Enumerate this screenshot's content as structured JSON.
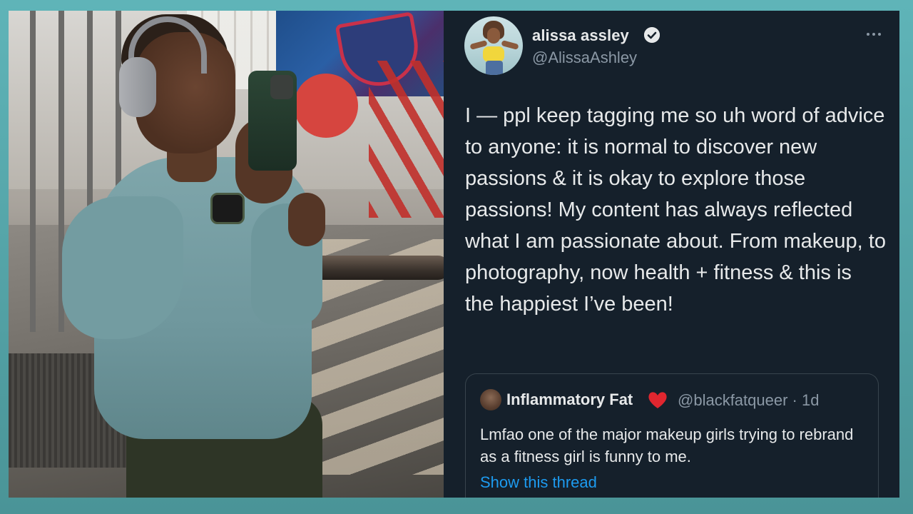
{
  "tweet": {
    "author": {
      "display_name": "alissa assley",
      "handle": "@AlissaAshley",
      "verified": true
    },
    "text": "I — ppl keep tagging me so uh word of advice to anyone: it is normal to discover new passions & it is okay to explore those passions! My content has always reflected what I am passionate about. From makeup, to photography, now health + fitness & this is the happiest I’ve been!",
    "quoted_tweet": {
      "display_name": "Inflammatory Fat",
      "emoji": "❤️",
      "handle_time": "@blackfatqueer · 1d",
      "text": "Lmfao one of the major makeup girls trying to rebrand as a fitness girl is funny to me.",
      "link_label": "Show this thread"
    }
  },
  "icons": [
    "verified-icon",
    "more-options-icon",
    "red-heart-icon"
  ],
  "colors": {
    "background_frame": "#5fb4b8",
    "tweet_bg": "#15202b",
    "text_primary": "#e7e9ea",
    "text_secondary": "#8b98a5",
    "link": "#1d9bf0",
    "border": "#38444d"
  }
}
